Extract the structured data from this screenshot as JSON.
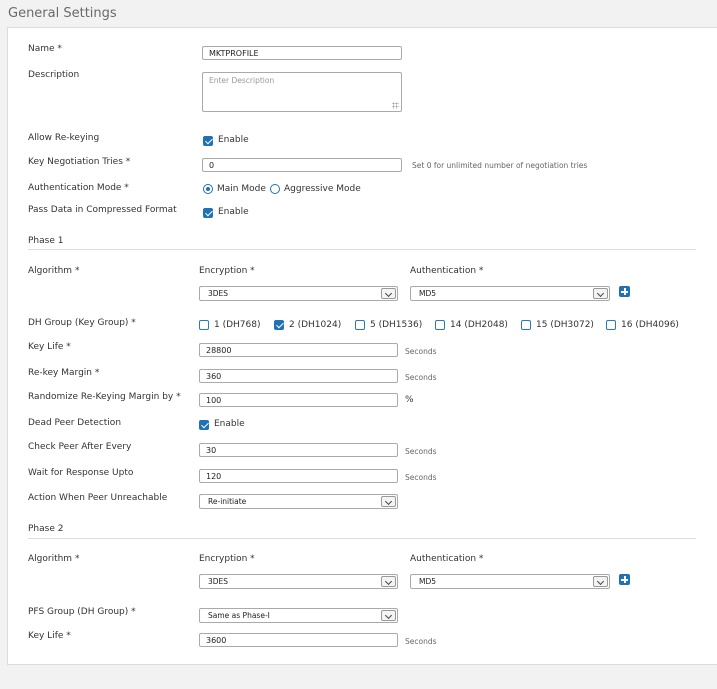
{
  "header": {
    "title": "General Settings"
  },
  "general": {
    "name_label": "Name *",
    "name_value": "MKTPROFILE",
    "description_label": "Description",
    "description_placeholder": "Enter Description",
    "allow_rekeying_label": "Allow Re-keying",
    "allow_rekeying_checked": true,
    "enable_label": "Enable",
    "key_negotiation_label": "Key Negotiation Tries *",
    "key_negotiation_value": "0",
    "key_negotiation_hint": "Set 0 for unlimited number of negotiation tries",
    "auth_mode_label": "Authentication Mode *",
    "auth_mode_options": [
      "Main Mode",
      "Aggressive Mode"
    ],
    "auth_mode_selected": "Main Mode",
    "compressed_label": "Pass Data in Compressed Format",
    "compressed_checked": true
  },
  "phase1": {
    "title": "Phase 1",
    "algorithm_label": "Algorithm *",
    "encryption_label": "Encryption *",
    "authentication_label": "Authentication *",
    "encryption_value": "3DES",
    "authentication_value": "MD5",
    "dh_group_label": "DH Group (Key Group) *",
    "dh_groups": [
      {
        "label": "1 (DH768)",
        "checked": false
      },
      {
        "label": "2 (DH1024)",
        "checked": true
      },
      {
        "label": "5 (DH1536)",
        "checked": false
      },
      {
        "label": "14 (DH2048)",
        "checked": false
      },
      {
        "label": "15 (DH3072)",
        "checked": false
      },
      {
        "label": "16 (DH4096)",
        "checked": false
      }
    ],
    "key_life_label": "Key Life *",
    "key_life_value": "28800",
    "seconds": "Seconds",
    "rekey_margin_label": "Re-key Margin *",
    "rekey_margin_value": "360",
    "randomize_label": "Randomize Re-Keying Margin by *",
    "randomize_value": "100",
    "percent": "%",
    "dpd_label": "Dead Peer Detection",
    "dpd_checked": true,
    "enable_label": "Enable",
    "check_peer_label": "Check Peer After Every",
    "check_peer_value": "30",
    "wait_label": "Wait for Response Upto",
    "wait_value": "120",
    "action_label": "Action When Peer Unreachable",
    "action_value": "Re-initiate"
  },
  "phase2": {
    "title": "Phase 2",
    "algorithm_label": "Algorithm *",
    "encryption_label": "Encryption *",
    "authentication_label": "Authentication *",
    "encryption_value": "3DES",
    "authentication_value": "MD5",
    "pfs_label": "PFS Group (DH Group) *",
    "pfs_value": "Same as Phase-I",
    "key_life_label": "Key Life *",
    "key_life_value": "3600",
    "seconds": "Seconds"
  },
  "colors": {
    "accent": "#1f72b4",
    "panel_bg": "#ffffff",
    "page_bg": "#f2f2f2"
  }
}
